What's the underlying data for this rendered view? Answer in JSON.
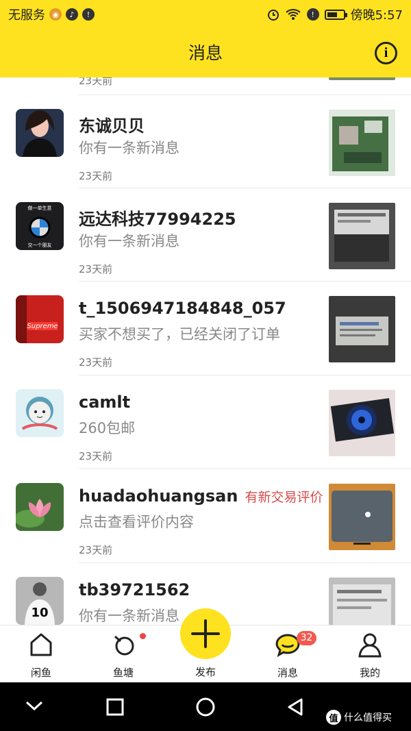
{
  "status_bar": {
    "carrier": "无服务",
    "time": "傍晚5:57"
  },
  "header": {
    "title": "消息",
    "info_icon": "info-icon"
  },
  "partial_row": {
    "time": "23天前"
  },
  "conversations": [
    {
      "name": "东诚贝贝",
      "tag": "",
      "preview": "你有一条新消息",
      "time": "23天前",
      "avatar_icon": "person-photo-avatar",
      "thumb_icon": "motherboard-photo"
    },
    {
      "name": "远达科技77994225",
      "tag": "",
      "preview": "你有一条新消息",
      "time": "23天前",
      "avatar_icon": "bmw-logo-avatar",
      "avatar_top_text": "做一单生意",
      "avatar_bottom_text": "交一个朋友",
      "thumb_icon": "power-supply-photo"
    },
    {
      "name": "t_1506947184848_057",
      "tag": "",
      "preview": "买家不想买了，已经关闭了订单",
      "time": "23天前",
      "avatar_icon": "supreme-avatar",
      "avatar_text": "Supreme",
      "thumb_icon": "power-supply-label-photo"
    },
    {
      "name": "camlt",
      "tag": "",
      "preview": "260包邮",
      "time": "23天前",
      "avatar_icon": "cat-avatar",
      "thumb_icon": "graphics-card-photo"
    },
    {
      "name": "huadaohuangsan",
      "tag": "有新交易评价",
      "preview": "点击查看评价内容",
      "time": "23天前",
      "avatar_icon": "lotus-avatar",
      "thumb_icon": "router-photo"
    },
    {
      "name": "tb39721562",
      "tag": "",
      "preview": "你有一条新消息",
      "time": "",
      "avatar_icon": "football-player-avatar",
      "avatar_text": "10",
      "thumb_icon": "power-supply-photo"
    }
  ],
  "tab_bar": {
    "tabs": [
      {
        "label": "闲鱼",
        "icon": "home-icon"
      },
      {
        "label": "鱼塘",
        "icon": "pond-icon"
      },
      {
        "label": "发布",
        "icon": "plus-icon"
      },
      {
        "label": "消息",
        "icon": "chat-bubble-icon",
        "badge": "32"
      },
      {
        "label": "我的",
        "icon": "profile-icon"
      }
    ]
  },
  "system_nav": {
    "buttons": [
      "back-icon",
      "home-circle-icon",
      "recent-apps-icon",
      "collapse-icon"
    ]
  },
  "watermark": {
    "badge": "值",
    "text": "什么值得买"
  },
  "colors": {
    "brand_yellow": "#ffe21f",
    "tag_red": "#d84b4b",
    "badge_red": "#f05a50",
    "muted_text": "#888888"
  },
  "battery_level": 0.65
}
